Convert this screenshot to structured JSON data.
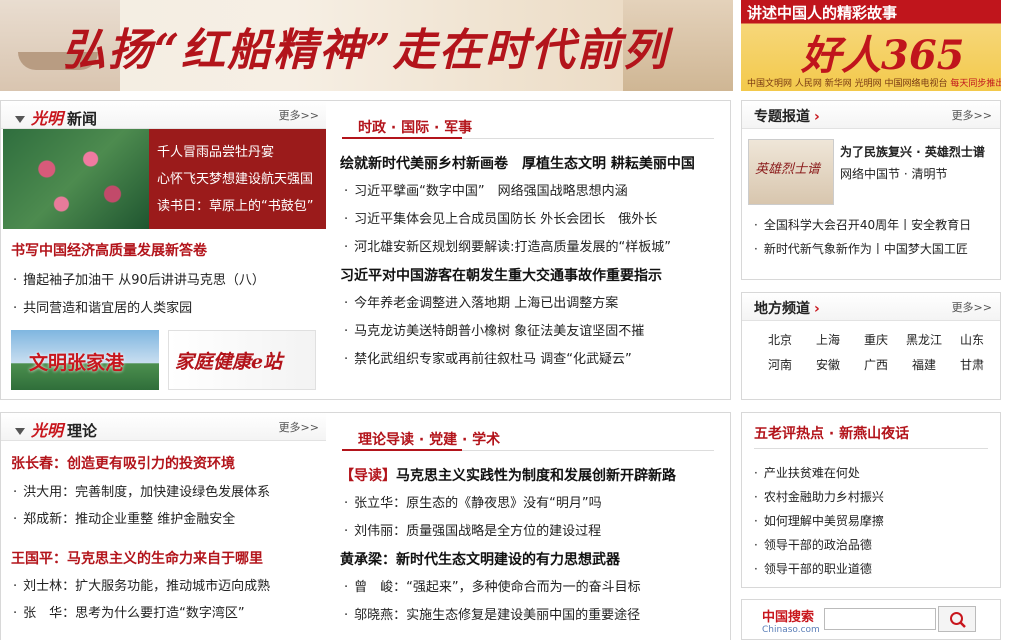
{
  "banner_main": {
    "slogan": "弘扬“红船精神”走在时代前列"
  },
  "banner_side": {
    "top_text": "讲述中国人的精彩故事",
    "big_text": "好人365",
    "sponsors": "中国文明网 人民网 新华网 光明网 中国网络电视台",
    "sponsor_tail": "每天同步推出"
  },
  "news": {
    "logo": "光明",
    "title": "新闻",
    "more": "更多>>",
    "feature_items": [
      "千人冒雨品尝牡丹宴",
      "心怀飞天梦想建设航天强国",
      "读书日：草原上的“书鼓包”"
    ],
    "headline": "书写中国经济高质量发展新答卷",
    "items": [
      "撸起袖子加油干 从90后讲讲马克思（八）",
      "共同营造和谐宜居的人类家园"
    ],
    "promo1": "文明张家港",
    "promo2": "家庭健康e站"
  },
  "politics": {
    "section": "时政 · 国际 · 军事",
    "lead1": "绘就新时代美丽乡村新画卷　厚植生态文明 耕耘美丽中国",
    "items1": [
      "习近平擘画“数字中国”　网络强国战略思想内涵",
      "习近平集体会见上合成员国防长 外长会团长　俄外长",
      "河北雄安新区规划纲要解读:打造高质量发展的“样板城”"
    ],
    "lead2": "习近平对中国游客在朝发生重大交通事故作重要指示",
    "items2": [
      "今年养老金调整进入落地期 上海已出调整方案",
      "马克龙访美送特朗普小橡树 象征法美友谊坚固不摧",
      "禁化武组织专家或再前往叙杜马 调查“化武疑云”"
    ]
  },
  "special": {
    "title": "专题报道",
    "more": "更多>>",
    "img_text": "英雄烈士谱",
    "feat_title": "为了民族复兴 · 英雄烈士谱",
    "feat_sub": "网络中国节 · 清明节",
    "items": [
      "全国科学大会召开40周年丨安全教育日",
      "新时代新气象新作为丨中国梦大国工匠"
    ]
  },
  "regional": {
    "title": "地方频道",
    "more": "更多>>",
    "cities": [
      "北京",
      "上海",
      "重庆",
      "黑龙江",
      "山东",
      "河南",
      "安徽",
      "广西",
      "福建",
      "甘肃"
    ]
  },
  "theory": {
    "logo": "光明",
    "title": "理论",
    "more": "更多>>",
    "head1": "张长春：创造更有吸引力的投资环境",
    "items1": [
      "洪大用：完善制度，加快建设绿色发展体系",
      "郑成新：推动企业重整 维护金融安全"
    ],
    "head2": "王国平：马克思主义的生命力来自于哪里",
    "items2": [
      "刘士林：扩大服务功能，推动城市迈向成熟",
      "张　华：思考为什么要打造“数字湾区”"
    ]
  },
  "guide": {
    "section": "理论导读 · 党建 · 学术",
    "lead1_tag": "【导读】",
    "lead1": "马克思主义实践性为制度和发展创新开辟新路",
    "items1": [
      "张立华：原生态的《静夜思》没有“明月”吗",
      "刘伟丽：质量强国战略是全方位的建设过程"
    ],
    "lead2": "黄承梁：新时代生态文明建设的有力思想武器",
    "items2": [
      "曾　峻：“强起来”，多种使命合而为一的奋斗目标",
      "邬晓燕：实施生态修复是建设美丽中国的重要途径"
    ]
  },
  "hotspot": {
    "title": "五老评热点 · 新燕山夜话",
    "items": [
      "产业扶贫难在何处",
      "农村金融助力乡村振兴",
      "如何理解中美贸易摩擦",
      "领导干部的政治品德",
      "领导干部的职业道德"
    ]
  },
  "search": {
    "logo": "中国搜索",
    "logo_sub": "Chinaso.com",
    "placeholder": ""
  }
}
